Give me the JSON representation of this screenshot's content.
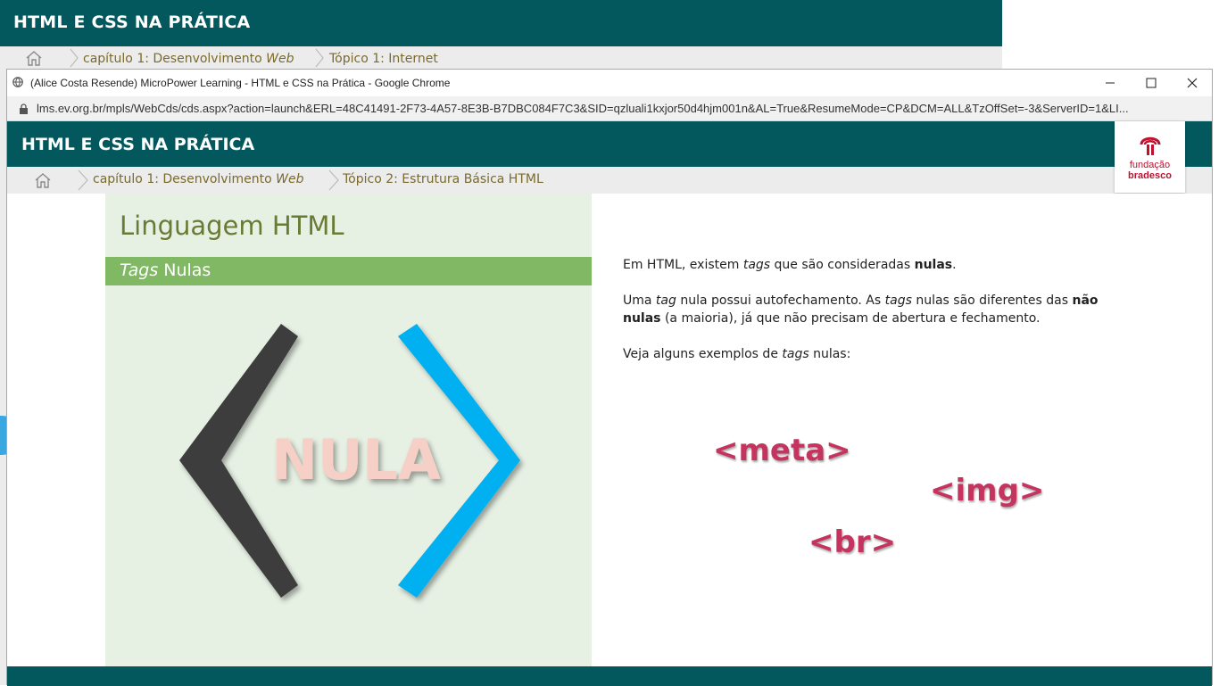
{
  "background": {
    "title": "HTML E CSS NA PRÁTICA",
    "breadcrumb": {
      "chapter_prefix": "capítulo 1: Desenvolvimento ",
      "chapter_em": "Web",
      "topic": "Tópico 1: Internet"
    }
  },
  "window": {
    "title": "(Alice Costa Resende) MicroPower Learning - HTML e CSS na Prática - Google Chrome",
    "url": "lms.ev.org.br/mpls/WebCds/cds.aspx?action=launch&ERL=48C41491-2F73-4A57-8E3B-B7DBC084F7C3&SID=qzluali1kxjor50d4hjm001n&AL=True&ResumeMode=CP&DCM=ALL&TzOffSet=-3&ServerID=1&LI..."
  },
  "app": {
    "title": "HTML E CSS NA PRÁTICA",
    "logo_line1": "fundação",
    "logo_line2": "bradesco",
    "breadcrumb": {
      "chapter_prefix": "capítulo 1: Desenvolvimento ",
      "chapter_em": "Web",
      "topic": "Tópico 2: Estrutura Básica HTML"
    }
  },
  "lesson": {
    "heading": "Linguagem HTML",
    "subheading_em": "Tags",
    "subheading_rest": " Nulas",
    "illustration_text": "NULA",
    "paragraphs": {
      "p1_a": "Em HTML, existem ",
      "p1_em": "tags",
      "p1_b": " que são consideradas ",
      "p1_strong": "nulas",
      "p1_c": ".",
      "p2_a": "Uma ",
      "p2_em1": "tag",
      "p2_b": " nula possui autofechamento. As ",
      "p2_em2": "tags",
      "p2_c": " nulas são diferentes das ",
      "p2_strong": "não nulas",
      "p2_d": " (a maioria), já que não precisam de abertura e fechamento.",
      "p3_a": "Veja alguns exemplos de ",
      "p3_em": "tags",
      "p3_b": " nulas:"
    },
    "examples": [
      "<meta>",
      "<img>",
      "<br>"
    ]
  },
  "colors": {
    "header": "#02585d",
    "panel": "#e6f0e3",
    "band": "#80b864",
    "tag_text": "#c4345e",
    "bracket_left": "#3d3d3d",
    "bracket_right": "#00b0f0",
    "nula_text": "#f6cfc6"
  }
}
